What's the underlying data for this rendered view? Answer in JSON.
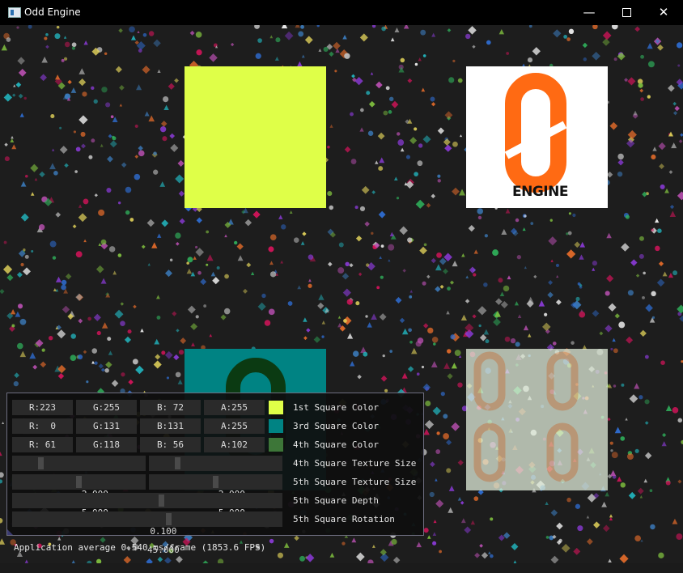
{
  "window": {
    "title": "Odd Engine",
    "minimize_glyph": "—",
    "close_glyph": "✕"
  },
  "scene": {
    "square1_color": "#dfff48",
    "square3_color": "#008383",
    "square4_color": "#3d7638",
    "logo_color": "#ff6a13",
    "logo_word": "ENGINE"
  },
  "panel": {
    "rows": [
      {
        "fields": [
          "R:223",
          "G:255",
          "B: 72",
          "A:255"
        ],
        "swatch": "#dfff48",
        "label": "1st Square Color"
      },
      {
        "fields": [
          "R:  0",
          "G:131",
          "B:131",
          "A:255"
        ],
        "swatch": "#008383",
        "label": "3rd Square Color"
      },
      {
        "fields": [
          "R: 61",
          "G:118",
          "B: 56",
          "A:102"
        ],
        "swatch": "#3d7638",
        "label": "4th Square Color"
      }
    ],
    "texture_size_4": {
      "x": "2.000",
      "y": "2.000",
      "label": "4th Square Texture Size"
    },
    "texture_size_5": {
      "x": "5.000",
      "y": "5.000",
      "label": "5th Square Texture Size"
    },
    "depth": {
      "value": "0.100",
      "label": "5th Square Depth"
    },
    "rotation": {
      "value": "45.000",
      "label": "5th Square Rotation"
    },
    "status": "Application average 0.540 ms/frame (1853.6 FPS)"
  }
}
